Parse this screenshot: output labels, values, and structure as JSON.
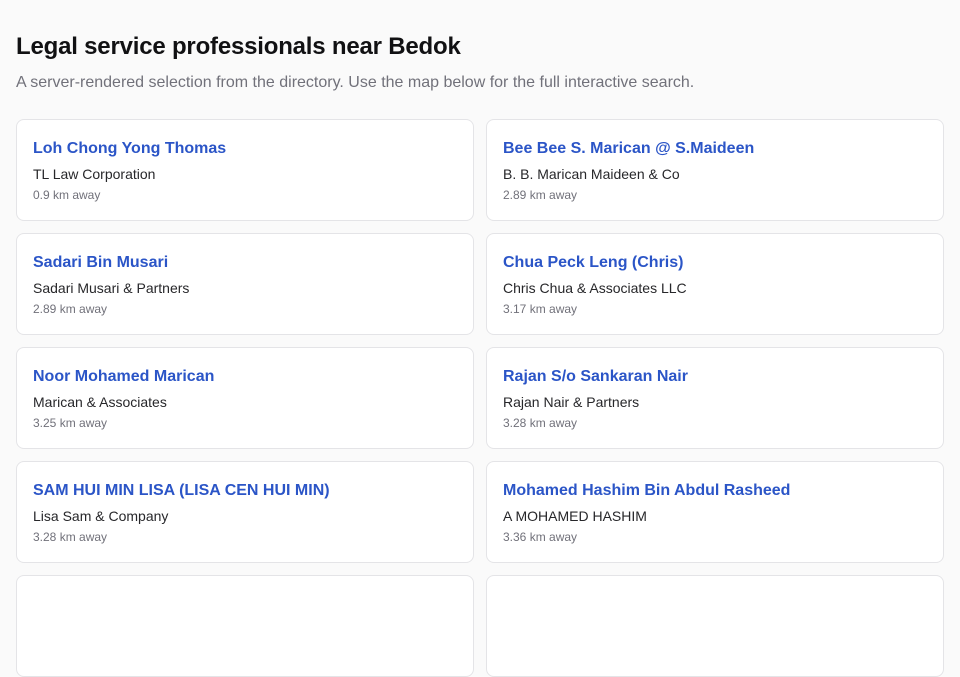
{
  "page": {
    "title": "Legal service professionals near Bedok",
    "subtitle": "A server-rendered selection from the directory. Use the map below for the full interactive search."
  },
  "results": [
    {
      "name": "Loh Chong Yong Thomas",
      "firm": "TL Law Corporation",
      "distance": "0.9 km away"
    },
    {
      "name": "Bee Bee S. Marican @ S.Maideen",
      "firm": "B. B. Marican Maideen & Co",
      "distance": "2.89 km away"
    },
    {
      "name": "Sadari Bin Musari",
      "firm": "Sadari Musari & Partners",
      "distance": "2.89 km away"
    },
    {
      "name": "Chua Peck Leng (Chris)",
      "firm": "Chris Chua & Associates LLC",
      "distance": "3.17 km away"
    },
    {
      "name": "Noor Mohamed Marican",
      "firm": "Marican & Associates",
      "distance": "3.25 km away"
    },
    {
      "name": "Rajan S/o Sankaran Nair",
      "firm": "Rajan Nair & Partners",
      "distance": "3.28 km away"
    },
    {
      "name": "SAM HUI MIN LISA (LISA CEN HUI MIN)",
      "firm": "Lisa Sam & Company",
      "distance": "3.28 km away"
    },
    {
      "name": "Mohamed Hashim Bin Abdul Rasheed",
      "firm": "A MOHAMED HASHIM",
      "distance": "3.36 km away"
    },
    {
      "name": "",
      "firm": "",
      "distance": ""
    },
    {
      "name": "",
      "firm": "",
      "distance": ""
    }
  ]
}
